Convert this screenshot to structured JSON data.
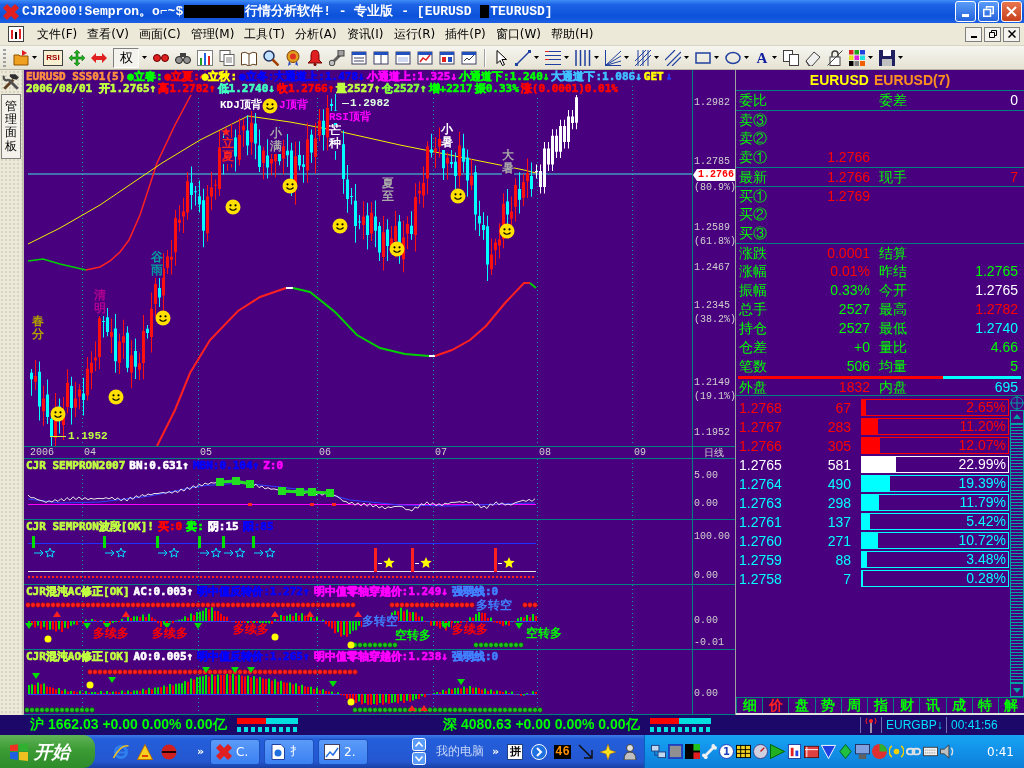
{
  "window": {
    "title": [
      {
        "kind": "text",
        "text": "CJR2000!Sempron。o⌐~$"
      },
      {
        "kind": "masked"
      },
      {
        "kind": "text",
        "text": "行情分析软件! - 专业版 - [EURUSD "
      },
      {
        "kind": "masked"
      },
      {
        "kind": "text",
        "text": "TEURUSD]"
      }
    ]
  },
  "menu": [
    "文件(F)",
    "查看(V)",
    "画面(C)",
    "管理(M)",
    "工具(T)",
    "分析(A)",
    "资讯(I)",
    "运行(R)",
    "插件(P)",
    "窗口(W)",
    "帮助(H)"
  ],
  "toolbar": {
    "rsi": "RSI",
    "rights": "权",
    "text_tool": "A"
  },
  "sidebar": {
    "tab": "管理面板"
  },
  "main_chart": {
    "readouts": [
      [
        {
          "text": "EURUSD SSS01(5)",
          "color": "#ff9040"
        },
        {
          "text": "●立春:",
          "color": "#00ff00"
        },
        {
          "text": "●立夏:",
          "color": "#ff0000"
        },
        {
          "text": "●立秋:",
          "color": "#ffff00"
        },
        {
          "text": "●立冬:大通道上:1.478↓",
          "color": "#0000ff"
        },
        {
          "text": "小通道上:1.325↓",
          "color": "#ff00ff"
        },
        {
          "text": "小通道下:1.240↓",
          "color": "#00ff00"
        },
        {
          "text": "大通道下:1.086↓",
          "color": "#40c0ff"
        },
        {
          "text": "GET",
          "color": "#ffff00"
        },
        {
          "text": "↓",
          "color": "#2040ff"
        }
      ],
      [
        {
          "text": "2006/08/01 开1.2765↑",
          "color": "#c0ff40"
        },
        {
          "text": "高1.2782↑",
          "color": "#ff0000"
        },
        {
          "text": "低1.2740↓",
          "color": "#40ffc0"
        },
        {
          "text": "收1.2766↑",
          "color": "#ff0000"
        },
        {
          "text": "量2527↑",
          "color": "#c0ff40"
        },
        {
          "text": "仓2527↑",
          "color": "#80ff40"
        },
        {
          "text": "增+2217",
          "color": "#00ff00"
        },
        {
          "text": "振0.33%",
          "color": "#00ff00"
        },
        {
          "text": "涨(0.0001)0.01%",
          "color": "#ff0000"
        }
      ]
    ],
    "annotations": [
      {
        "text": "KDJ顶背",
        "color": "#ffffff",
        "kind": "horizontal"
      },
      {
        "text": "J顶背",
        "color": "#ff00ff",
        "kind": "horizontal"
      },
      {
        "text": "1.2982",
        "color": "#e0ffe0",
        "kind": "leader"
      },
      {
        "text": "RSI顶背",
        "color": "#ff00ff",
        "kind": "horizontal"
      },
      {
        "text": "立夏",
        "color": "#ff2020",
        "kind": "vertical"
      },
      {
        "text": "小满",
        "color": "#a8a8a8",
        "kind": "vertical"
      },
      {
        "text": "芒种",
        "color": "#ffffff",
        "kind": "vertical"
      },
      {
        "text": "夏至",
        "color": "#a8a8a8",
        "kind": "vertical"
      },
      {
        "text": "小暑",
        "color": "#ffffff",
        "kind": "vertical"
      },
      {
        "text": "大暑",
        "color": "#a8a8a8",
        "kind": "vertical"
      },
      {
        "text": "谷雨",
        "color": "#00a0a0",
        "kind": "vertical"
      },
      {
        "text": "清明",
        "color": "#b00090",
        "kind": "vertical"
      },
      {
        "text": "春分",
        "color": "#b0a000",
        "kind": "vertical"
      },
      {
        "text": "1.1952",
        "color": "#c0ff40",
        "kind": "leader"
      }
    ],
    "price_axis": [
      "1.2982",
      "1.2785",
      "(80.9%)",
      "1.2589",
      "(61.8%)",
      "1.2467",
      "1.2345",
      "(38.2%)",
      "1.2149",
      "(19.1%)",
      "1.1952"
    ],
    "current_price": "1.2766",
    "time_axis": [
      "2006",
      "04",
      "05",
      "06",
      "07",
      "08",
      "09"
    ],
    "period": "日线"
  },
  "indicators": [
    {
      "kind": "oscillator",
      "readouts": [
        {
          "text": "CJR SEMPRON2007",
          "color": "#c0ff40"
        },
        {
          "text": "BN:0.631↑",
          "color": "#ffffff"
        },
        {
          "text": "MBN:0.104↑",
          "color": "#0000ff"
        },
        {
          "text": "Z:0",
          "color": "#ff00ff"
        }
      ],
      "axis": [
        "5.00",
        "0.00"
      ]
    },
    {
      "kind": "band",
      "readouts": [
        {
          "text": "CJR SEMPRON波段[OK]!",
          "color": "#c0ff40"
        },
        {
          "text": "买:0",
          "color": "#ff0000"
        },
        {
          "text": "卖:",
          "color": "#00ff00"
        },
        {
          "text": "阴:15",
          "color": "#ffffff"
        },
        {
          "text": "阳:85",
          "color": "#0000ff"
        }
      ],
      "axis": [
        "100.00",
        "0.00"
      ]
    },
    {
      "kind": "ac",
      "readouts": [
        {
          "text": "CJR混沌AC修正[OK]",
          "color": "#c0ff40"
        },
        {
          "text": "AC:0.003↑",
          "color": "#ffffff"
        },
        {
          "text": "明中值反转价:1.272↑",
          "color": "#0000ff"
        },
        {
          "text": "明中值零轴穿越价:1.249↓",
          "color": "#ff00ff"
        },
        {
          "text": "强弱线:0",
          "color": "#4080ff"
        }
      ],
      "axis": [
        "0.00",
        "-0.01"
      ],
      "signals": [
        {
          "text": "多续多",
          "color": "#ff0000"
        },
        {
          "text": "多续多",
          "color": "#ff0000"
        },
        {
          "text": "多续多",
          "color": "#ff0000"
        },
        {
          "text": "多转空",
          "color": "#4080ff"
        },
        {
          "text": "空转多",
          "color": "#00ff00"
        },
        {
          "text": "多续多",
          "color": "#ff0000"
        },
        {
          "text": "多转空",
          "color": "#4080ff"
        },
        {
          "text": "空转多",
          "color": "#00ff00"
        }
      ]
    },
    {
      "kind": "ao",
      "readouts": [
        {
          "text": "CJR混沌AO修正[OK]",
          "color": "#c0ff40"
        },
        {
          "text": "AO:0.005↑",
          "color": "#ffffff"
        },
        {
          "text": "明中值反转价:1.265↑",
          "color": "#0000ff"
        },
        {
          "text": "明中值零轴穿越价:1.238↓",
          "color": "#ff00ff"
        },
        {
          "text": "强弱线:0",
          "color": "#4080ff"
        }
      ],
      "axis": [
        "0.00"
      ]
    }
  ],
  "quote_panel": {
    "title": [
      {
        "text": "EURUSD",
        "color": "#ffff00"
      },
      {
        "text": "EURUSD(7)",
        "color": "#ff9020"
      }
    ],
    "ratio": {
      "label": "委比",
      "right": {
        "label": "委差",
        "value": "0",
        "color": "#ffffff"
      }
    },
    "asks": [
      {
        "label": "卖③"
      },
      {
        "label": "卖②"
      },
      {
        "label": "卖①",
        "value": "1.2766",
        "color": "#ff0000"
      }
    ],
    "last": {
      "label": "最新",
      "value": "1.2766",
      "color": "#ff0000",
      "right": {
        "label": "现手",
        "value": "7",
        "color": "#ff0000"
      }
    },
    "bids": [
      {
        "label": "买①",
        "value": "1.2769",
        "color": "#ff0000"
      },
      {
        "label": "买②"
      },
      {
        "label": "买③"
      }
    ],
    "stats": [
      {
        "label": "涨跌",
        "value": "0.0001",
        "color": "#ff0000",
        "right": {
          "label": "结算"
        }
      },
      {
        "label": "涨幅",
        "value": "0.01%",
        "color": "#ff0000",
        "right": {
          "label": "昨结",
          "value": "1.2765",
          "color": "#00ff00"
        }
      },
      {
        "label": "振幅",
        "value": "0.33%",
        "color": "#00ff00",
        "right": {
          "label": "今开",
          "value": "1.2765",
          "color": "#ffffff"
        }
      },
      {
        "label": "总手",
        "value": "2527",
        "color": "#00ff00",
        "right": {
          "label": "最高",
          "value": "1.2782",
          "color": "#ff0000"
        }
      },
      {
        "label": "持仓",
        "value": "2527",
        "color": "#00ff00",
        "right": {
          "label": "最低",
          "value": "1.2740",
          "color": "#00ffff"
        }
      },
      {
        "label": "仓差",
        "value": "+0",
        "color": "#00ff00",
        "right": {
          "label": "量比",
          "value": "4.66",
          "color": "#00ff00"
        }
      },
      {
        "label": "笔数",
        "value": "506",
        "color": "#00ff00",
        "right": {
          "label": "均量",
          "value": "5",
          "color": "#00ff00"
        }
      }
    ],
    "flow_bar": {
      "level": 0.725
    },
    "flow": {
      "label": "外盘",
      "value": "1832",
      "color": "#ff0000",
      "right": {
        "label": "内盘",
        "value": "695",
        "color": "#00ffff"
      }
    },
    "ladder": [
      {
        "price": "1.2768",
        "volume": "67",
        "share": "2.65%",
        "level": 0.0265,
        "color": "#ff0000"
      },
      {
        "price": "1.2767",
        "volume": "283",
        "share": "11.20%",
        "level": 0.112,
        "color": "#ff0000"
      },
      {
        "price": "1.2766",
        "volume": "305",
        "share": "12.07%",
        "level": 0.1207,
        "color": "#ff0000"
      },
      {
        "price": "1.2765",
        "volume": "581",
        "share": "22.99%",
        "level": 0.2299,
        "color": "#ffffff"
      },
      {
        "price": "1.2764",
        "volume": "490",
        "share": "19.39%",
        "level": 0.1939,
        "color": "#00ffff"
      },
      {
        "price": "1.2763",
        "volume": "298",
        "share": "11.79%",
        "level": 0.1179,
        "color": "#00ffff"
      },
      {
        "price": "1.2761",
        "volume": "137",
        "share": "5.42%",
        "level": 0.0542,
        "color": "#00ffff"
      },
      {
        "price": "1.2760",
        "volume": "271",
        "share": "10.72%",
        "level": 0.1072,
        "color": "#00ffff"
      },
      {
        "price": "1.2759",
        "volume": "88",
        "share": "3.48%",
        "level": 0.0348,
        "color": "#00ffff"
      },
      {
        "price": "1.2758",
        "volume": "7",
        "share": "0.28%",
        "level": 0.0028,
        "color": "#00ffff"
      }
    ],
    "tabs": [
      {
        "label": "细",
        "selected": false
      },
      {
        "label": "价",
        "selected": true
      },
      {
        "label": "盘",
        "selected": false
      },
      {
        "label": "势",
        "selected": false
      },
      {
        "label": "周",
        "selected": false
      },
      {
        "label": "指",
        "selected": false
      },
      {
        "label": "财",
        "selected": false
      },
      {
        "label": "讯",
        "selected": false
      },
      {
        "label": "成",
        "selected": false
      },
      {
        "label": "特",
        "selected": false
      },
      {
        "label": "解",
        "selected": false
      }
    ]
  },
  "status_bar": {
    "markets": [
      {
        "text": "沪 1662.03 +0.00 0.00% 0.00亿",
        "level": 0.49
      },
      {
        "text": "深 4080.63 +0.00 0.00% 0.00亿",
        "level": 0.49
      }
    ],
    "symbol": "EURGBP↓",
    "time": "00:41:56"
  },
  "taskbar": {
    "start": "开始",
    "quick_more": "»",
    "tasks": [
      {
        "label": "C.",
        "selected": false
      },
      {
        "label": "扌",
        "selected": false
      },
      {
        "label": "2.",
        "selected": false
      }
    ],
    "toolbar_label": "我的电脑",
    "toolbar_more": "»",
    "ime": "拼",
    "counter": "46",
    "badge": "1",
    "clock": "0:41"
  }
}
